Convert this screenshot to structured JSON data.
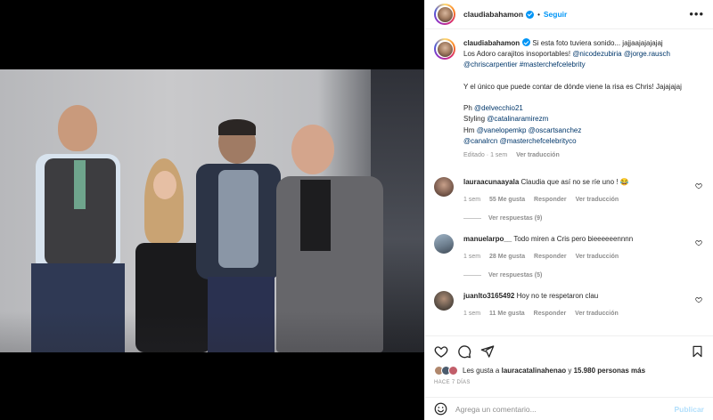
{
  "post": {
    "author": "claudiabahamon",
    "separator": "•",
    "follow_label": "Seguir",
    "more_label": "•••",
    "caption_user": "claudiabahamon",
    "caption_lines": [
      "Si esta foto tuviera sonido... jajjaajajajajaj",
      "Los Adoro carajitos insoportables!"
    ],
    "mentions_1": [
      "@nicodezubiria",
      "@jorge.rausch",
      "@chriscarpentier",
      "#masterchefcelebrity"
    ],
    "caption_p2": "Y el único que puede contar de dónde viene la risa es Chris! Jajajajaj",
    "credits": {
      "ph_label": "Ph",
      "ph_user": "@delvecchio21",
      "styling_label": "Styling",
      "styling_user": "@catalinaramirezm",
      "hm_label": "Hm",
      "hm_users": [
        "@vanelopemkp",
        "@oscartsanchez"
      ],
      "tags": [
        "@canalrcn",
        "@masterchefcelebrityco"
      ]
    },
    "meta": {
      "edited": "Editado",
      "time": "1 sem",
      "translate": "Ver traducción"
    }
  },
  "comments": [
    {
      "user": "lauraacunaayala",
      "text": "Claudia que así no se ríe uno ! 😂",
      "time": "1 sem",
      "likes": "55 Me gusta",
      "reply": "Responder",
      "translate": "Ver traducción",
      "replies": "Ver respuestas (9)",
      "avatar_color": "#7a5b4d"
    },
    {
      "user": "manuelarpo__",
      "text": "Todo miren a Cris pero bieeeeeennnn",
      "time": "1 sem",
      "likes": "28 Me gusta",
      "reply": "Responder",
      "translate": "Ver traducción",
      "replies": "Ver respuestas (5)",
      "avatar_color": "#6e7f8f"
    },
    {
      "user": "juanlto3165492",
      "text": "Hoy no te respetaron clau",
      "time": "1 sem",
      "likes": "11 Me gusta",
      "reply": "Responder",
      "translate": "Ver traducción",
      "avatar_color": "#5d5147"
    }
  ],
  "likes": {
    "prefix": "Les gusta a",
    "user": "lauracatalinahenao",
    "conj": "y",
    "count": "15.980 personas más"
  },
  "time_ago": "HACE 7 DÍAS",
  "comment_input": {
    "placeholder": "Agrega un comentario...",
    "publish": "Publicar"
  },
  "colors": {
    "link": "#00376b",
    "accent": "#0095f6",
    "muted": "#8e8e8e"
  }
}
